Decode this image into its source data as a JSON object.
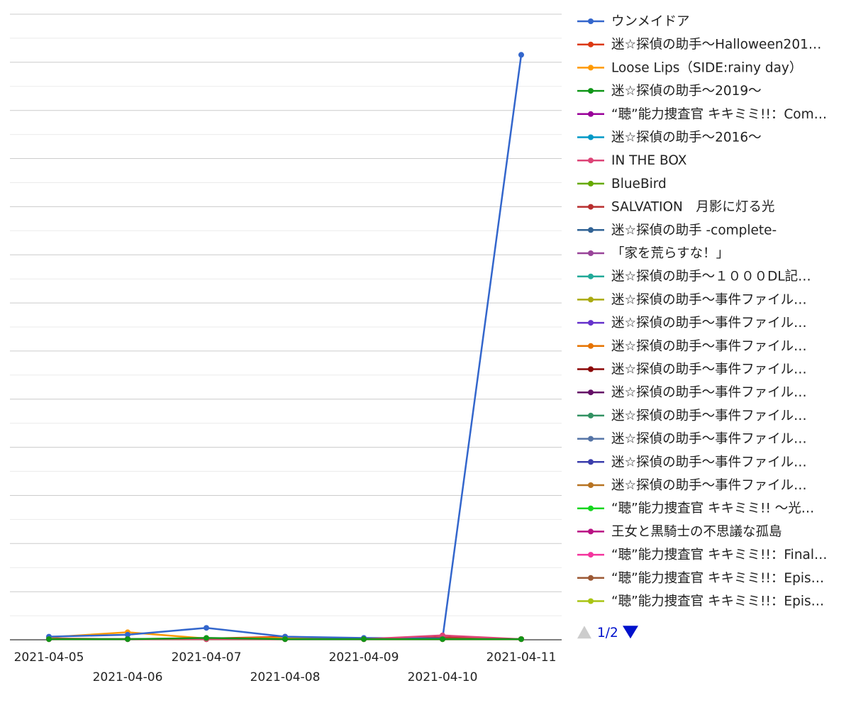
{
  "chart_data": {
    "type": "line",
    "title": "",
    "xlabel": "",
    "ylabel": "",
    "x": [
      "2021-04-05",
      "2021-04-06",
      "2021-04-07",
      "2021-04-08",
      "2021-04-09",
      "2021-04-10",
      "2021-04-11"
    ],
    "ylim": [
      0,
      100
    ],
    "grid": true,
    "legend_position": "right",
    "pager": {
      "label": "1/2",
      "prev_enabled": false,
      "next_enabled": true
    },
    "series": [
      {
        "name": "ウンメイドア",
        "color": "#3366cc",
        "values": [
          0.5,
          0.8,
          1.9,
          0.5,
          0.3,
          0.2,
          93.5
        ]
      },
      {
        "name": "迷☆探偵の助手〜Halloween201…",
        "color": "#dc3912",
        "values": [
          0.2,
          0.1,
          0.2,
          0.5,
          0.1,
          0.3,
          0.1
        ]
      },
      {
        "name": "Loose Lips（SIDE:rainy day）",
        "color": "#ff9900",
        "values": [
          0.4,
          1.2,
          0.2,
          0.3,
          0.1,
          0.1,
          0.1
        ]
      },
      {
        "name": "迷☆探偵の助手〜2019〜",
        "color": "#109618",
        "values": [
          0.1,
          0.1,
          0.3,
          0.1,
          0.1,
          0.1,
          0.1
        ]
      },
      {
        "name": "“聴”能力捜査官 キキミミ!!：Com…",
        "color": "#990099",
        "values": [
          0.1,
          0.1,
          0.1,
          0.1,
          0.1,
          0.2,
          0.1
        ]
      },
      {
        "name": "迷☆探偵の助手〜2016〜",
        "color": "#0099c6",
        "values": [
          0.1,
          0.1,
          0.1,
          0.1,
          0.1,
          0.1,
          0.1
        ]
      },
      {
        "name": "IN THE BOX",
        "color": "#dd4477",
        "values": [
          0.1,
          0.1,
          0.1,
          0.1,
          0.1,
          0.7,
          0.1
        ]
      },
      {
        "name": "BlueBird",
        "color": "#66aa00",
        "values": [
          0.1,
          0.1,
          0.1,
          0.1,
          0.1,
          0.1,
          0.1
        ]
      },
      {
        "name": "SALVATION　月影に灯る光",
        "color": "#b82e2e",
        "values": [
          0.1,
          0.1,
          0.1,
          0.3,
          0.1,
          0.4,
          0.1
        ]
      },
      {
        "name": "迷☆探偵の助手 -complete-",
        "color": "#316395",
        "values": [
          0.1,
          0.1,
          0.1,
          0.1,
          0.1,
          0.1,
          0.1
        ]
      },
      {
        "name": "「家を荒らすな！」",
        "color": "#994499",
        "values": [
          0.1,
          0.1,
          0.1,
          0.1,
          0.1,
          0.1,
          0.1
        ]
      },
      {
        "name": "迷☆探偵の助手〜１０００DL記…",
        "color": "#22aa99",
        "values": [
          0.1,
          0.1,
          0.1,
          0.1,
          0.1,
          0.1,
          0.1
        ]
      },
      {
        "name": "迷☆探偵の助手〜事件ファイル…",
        "color": "#aaaa11",
        "values": [
          0.1,
          0.1,
          0.1,
          0.1,
          0.1,
          0.1,
          0.1
        ]
      },
      {
        "name": "迷☆探偵の助手〜事件ファイル…",
        "color": "#6633cc",
        "values": [
          0.1,
          0.1,
          0.1,
          0.1,
          0.1,
          0.1,
          0.1
        ]
      },
      {
        "name": "迷☆探偵の助手〜事件ファイル…",
        "color": "#e67300",
        "values": [
          0.1,
          0.1,
          0.1,
          0.1,
          0.1,
          0.1,
          0.1
        ]
      },
      {
        "name": "迷☆探偵の助手〜事件ファイル…",
        "color": "#8b0707",
        "values": [
          0.1,
          0.1,
          0.1,
          0.1,
          0.1,
          0.1,
          0.1
        ]
      },
      {
        "name": "迷☆探偵の助手〜事件ファイル…",
        "color": "#651067",
        "values": [
          0.1,
          0.1,
          0.1,
          0.1,
          0.1,
          0.1,
          0.1
        ]
      },
      {
        "name": "迷☆探偵の助手〜事件ファイル…",
        "color": "#329262",
        "values": [
          0.1,
          0.1,
          0.1,
          0.1,
          0.1,
          0.1,
          0.1
        ]
      },
      {
        "name": "迷☆探偵の助手〜事件ファイル…",
        "color": "#5574a6",
        "values": [
          0.1,
          0.1,
          0.1,
          0.1,
          0.1,
          0.1,
          0.1
        ]
      },
      {
        "name": "迷☆探偵の助手〜事件ファイル…",
        "color": "#3b3eac",
        "values": [
          0.1,
          0.1,
          0.1,
          0.1,
          0.1,
          0.1,
          0.1
        ]
      },
      {
        "name": "迷☆探偵の助手〜事件ファイル…",
        "color": "#b77322",
        "values": [
          0.1,
          0.1,
          0.1,
          0.1,
          0.1,
          0.1,
          0.1
        ]
      },
      {
        "name": "“聴”能力捜査官 キキミミ!! 〜光…",
        "color": "#16d620",
        "values": [
          0.1,
          0.1,
          0.1,
          0.1,
          0.1,
          0.1,
          0.1
        ]
      },
      {
        "name": "王女と黒騎士の不思議な孤島",
        "color": "#b91383",
        "values": [
          0.1,
          0.1,
          0.1,
          0.1,
          0.1,
          0.1,
          0.1
        ]
      },
      {
        "name": "“聴”能力捜査官 キキミミ!!：Final…",
        "color": "#f4359e",
        "values": [
          0.1,
          0.1,
          0.1,
          0.1,
          0.1,
          0.1,
          0.1
        ]
      },
      {
        "name": "“聴”能力捜査官 キキミミ!!：Epis…",
        "color": "#9c5935",
        "values": [
          0.1,
          0.1,
          0.1,
          0.1,
          0.1,
          0.1,
          0.1
        ]
      },
      {
        "name": "“聴”能力捜査官 キキミミ!!：Epis…",
        "color": "#a9c413",
        "values": [
          0.1,
          0.1,
          0.1,
          0.1,
          0.1,
          0.1,
          0.1
        ]
      }
    ],
    "top_series": [
      "#ff9900",
      "#3366cc",
      "#dd4477",
      "#109618"
    ]
  }
}
